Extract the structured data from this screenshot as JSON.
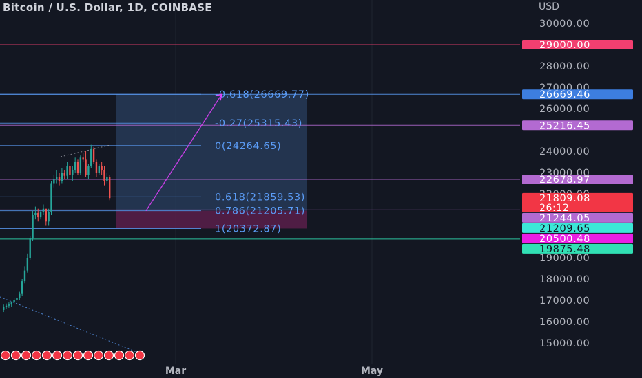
{
  "header": {
    "title": "Bitcoin / U.S. Dollar, 1D, COINBASE",
    "currency": "USD"
  },
  "colors": {
    "background": "#131722",
    "up": "#26a69a",
    "down": "#ef5350",
    "fib_text": "#5b9cf6",
    "fib_line": "#5b9cf6",
    "projection": "#e040fb",
    "box_fill": "#2a3f5f",
    "box_fill_loss": "#5a1e4a",
    "grid": "#1f2430",
    "axis_text": "#b2b5be"
  },
  "chart_data": {
    "type": "candlestick",
    "title": "Bitcoin / U.S. Dollar, 1D, COINBASE",
    "ylabel": "USD",
    "ylim": [
      14000,
      31200
    ],
    "y_ticks": [
      "30000.00",
      "28000.00",
      "27000.00",
      "26000.00",
      "24000.00",
      "23000.00",
      "22000.00",
      "19000.00",
      "18000.00",
      "17000.00",
      "16000.00",
      "15000.00"
    ],
    "x_ticks": [
      "Mar",
      "May"
    ],
    "fib_levels": [
      {
        "label": "-0.618(26669.77)",
        "value": 26669.77
      },
      {
        "label": "-0.27(25315.43)",
        "value": 25315.43
      },
      {
        "label": "0(24264.65)",
        "value": 24264.65
      },
      {
        "label": "0.618(21859.53)",
        "value": 21859.53
      },
      {
        "label": "0.786(21205.71)",
        "value": 21205.71
      },
      {
        "label": "1(20372.87)",
        "value": 20372.87
      }
    ],
    "horizontal_lines": [
      29000.0,
      26669.46,
      25216.45,
      22678.97,
      21244.05,
      19875.48
    ],
    "price_tags": [
      {
        "label": "29000.00",
        "value": 29000.0,
        "color": "#f23f70"
      },
      {
        "label": "26669.46",
        "value": 26669.46,
        "color": "#3d7ee0"
      },
      {
        "label": "25216.45",
        "value": 25216.45,
        "color": "#b36ad1"
      },
      {
        "label": "22678.97",
        "value": 22678.97,
        "color": "#b36ad1"
      },
      {
        "label": "21809.08",
        "value": 21809.08,
        "color": "#f23645",
        "sub": "26:12"
      },
      {
        "label": "21244.05",
        "value": 21244.05,
        "color": "#b36ad1"
      },
      {
        "label": "21209.65",
        "value": 21209.65,
        "color": "#3ce7d7",
        "text_color": "#131722"
      },
      {
        "label": "20500.48",
        "value": 20500.48,
        "color": "#e91ee4"
      },
      {
        "label": "19875.48",
        "value": 19875.48,
        "color": "#31e0b4",
        "text_color": "#131722"
      }
    ],
    "position_box": {
      "top": 26669.77,
      "entry": 21205.71,
      "bottom": 20372.87
    },
    "projection": {
      "from": 21205.71,
      "to": 26669.77
    },
    "candles": [
      {
        "o": 16550,
        "h": 16800,
        "l": 16450,
        "c": 16700
      },
      {
        "o": 16700,
        "h": 16850,
        "l": 16600,
        "c": 16750
      },
      {
        "o": 16750,
        "h": 16900,
        "l": 16650,
        "c": 16800
      },
      {
        "o": 16800,
        "h": 16950,
        "l": 16700,
        "c": 16900
      },
      {
        "o": 16900,
        "h": 17100,
        "l": 16800,
        "c": 17000
      },
      {
        "o": 17000,
        "h": 17150,
        "l": 16900,
        "c": 17100
      },
      {
        "o": 17100,
        "h": 17400,
        "l": 17000,
        "c": 17300
      },
      {
        "o": 17300,
        "h": 18000,
        "l": 17200,
        "c": 17900
      },
      {
        "o": 17900,
        "h": 18600,
        "l": 17800,
        "c": 18400
      },
      {
        "o": 18400,
        "h": 19200,
        "l": 18300,
        "c": 19000
      },
      {
        "o": 19000,
        "h": 20000,
        "l": 18900,
        "c": 19900
      },
      {
        "o": 19900,
        "h": 21200,
        "l": 19800,
        "c": 21000
      },
      {
        "o": 21000,
        "h": 21400,
        "l": 20800,
        "c": 21100
      },
      {
        "o": 21100,
        "h": 21300,
        "l": 20700,
        "c": 20900
      },
      {
        "o": 20900,
        "h": 21250,
        "l": 20800,
        "c": 21150
      },
      {
        "o": 21150,
        "h": 21500,
        "l": 21000,
        "c": 21300
      },
      {
        "o": 21300,
        "h": 21200,
        "l": 20500,
        "c": 20700
      },
      {
        "o": 20700,
        "h": 21300,
        "l": 20500,
        "c": 21150
      },
      {
        "o": 21150,
        "h": 22600,
        "l": 21000,
        "c": 22500
      },
      {
        "o": 22500,
        "h": 22900,
        "l": 22300,
        "c": 22700
      },
      {
        "o": 22700,
        "h": 23100,
        "l": 22500,
        "c": 22800
      },
      {
        "o": 22800,
        "h": 23000,
        "l": 22400,
        "c": 22600
      },
      {
        "o": 22600,
        "h": 23200,
        "l": 22500,
        "c": 23000
      },
      {
        "o": 23000,
        "h": 23100,
        "l": 22700,
        "c": 22850
      },
      {
        "o": 22850,
        "h": 23500,
        "l": 22700,
        "c": 23300
      },
      {
        "o": 23300,
        "h": 23400,
        "l": 22800,
        "c": 22900
      },
      {
        "o": 22900,
        "h": 23300,
        "l": 22600,
        "c": 23100
      },
      {
        "o": 23100,
        "h": 23700,
        "l": 23000,
        "c": 23500
      },
      {
        "o": 23500,
        "h": 23600,
        "l": 22900,
        "c": 23000
      },
      {
        "o": 23000,
        "h": 23800,
        "l": 22900,
        "c": 23700
      },
      {
        "o": 23700,
        "h": 23900,
        "l": 23500,
        "c": 23600
      },
      {
        "o": 23600,
        "h": 24000,
        "l": 22800,
        "c": 22900
      },
      {
        "o": 22900,
        "h": 23400,
        "l": 22700,
        "c": 23300
      },
      {
        "o": 23300,
        "h": 24300,
        "l": 23200,
        "c": 24100
      },
      {
        "o": 24100,
        "h": 24200,
        "l": 23400,
        "c": 23500
      },
      {
        "o": 23500,
        "h": 23600,
        "l": 22800,
        "c": 23000
      },
      {
        "o": 23000,
        "h": 23400,
        "l": 22900,
        "c": 23300
      },
      {
        "o": 23300,
        "h": 23500,
        "l": 22900,
        "c": 23100
      },
      {
        "o": 23100,
        "h": 23300,
        "l": 22400,
        "c": 22600
      },
      {
        "o": 22600,
        "h": 23000,
        "l": 22500,
        "c": 22800
      },
      {
        "o": 22800,
        "h": 22900,
        "l": 21700,
        "c": 21800
      }
    ]
  }
}
